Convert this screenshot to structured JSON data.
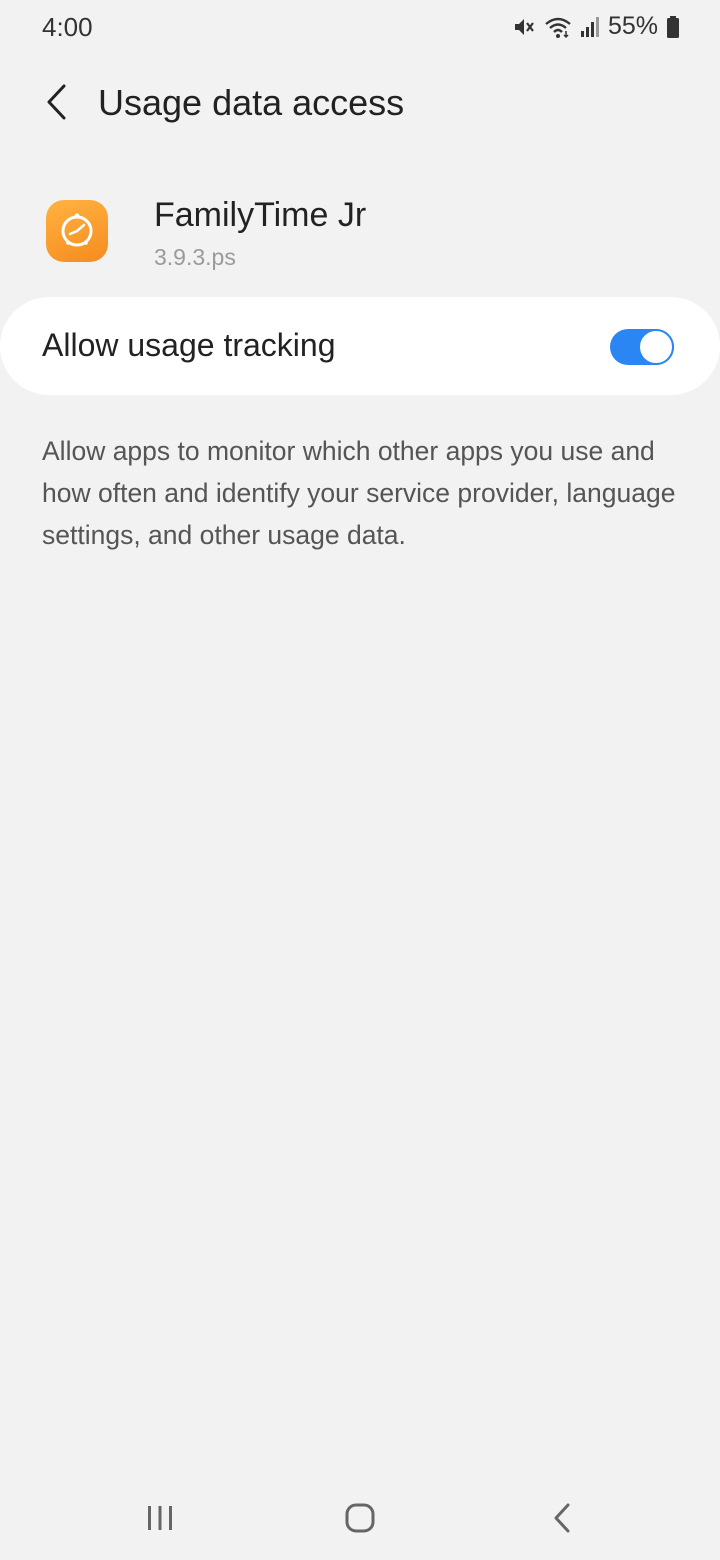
{
  "status_bar": {
    "time": "4:00",
    "battery": "55%",
    "icons": [
      "mute-icon",
      "wifi-icon",
      "signal-icon",
      "battery-icon"
    ]
  },
  "header": {
    "title": "Usage data access",
    "back_icon": "chevron-left-icon"
  },
  "app": {
    "name": "FamilyTime Jr",
    "version": "3.9.3.ps",
    "icon": "familytime-clock-icon",
    "icon_color": "#f68b1f"
  },
  "setting": {
    "label": "Allow usage tracking",
    "enabled": true,
    "accent_color": "#2a86f3"
  },
  "description": "Allow apps to monitor which other apps you use and how often and identify your service provider, language settings, and other usage data.",
  "nav_bar": {
    "buttons": [
      "recents-icon",
      "home-icon",
      "back-icon"
    ]
  }
}
